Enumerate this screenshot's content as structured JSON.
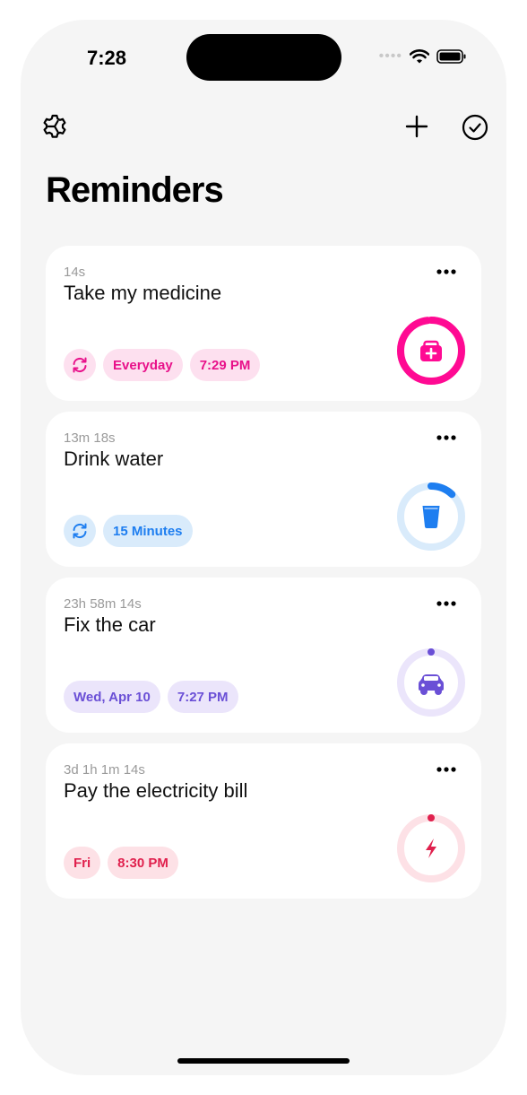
{
  "status_bar": {
    "time": "7:28"
  },
  "toolbar": {
    "settings_icon": "gear-icon",
    "add_icon": "plus-icon",
    "done_icon": "check-circle-icon"
  },
  "page": {
    "title": "Reminders"
  },
  "colors": {
    "pink": "#ff0a93",
    "blue": "#1e7ef0",
    "purple": "#6a4fd6",
    "red": "#e0204d"
  },
  "reminders": [
    {
      "time_left": "14s",
      "title": "Take my medicine",
      "repeat": true,
      "tags": [
        "Everyday",
        "7:29 PM"
      ],
      "icon": "medical-kit-icon",
      "progress": 0.98
    },
    {
      "time_left": "13m 18s",
      "title": "Drink water",
      "repeat": true,
      "tags": [
        "15 Minutes"
      ],
      "icon": "water-glass-icon",
      "progress": 0.12
    },
    {
      "time_left": "23h 58m 14s",
      "title": "Fix the car",
      "repeat": false,
      "tags": [
        "Wed, Apr 10",
        "7:27 PM"
      ],
      "icon": "car-icon",
      "progress": 0.0
    },
    {
      "time_left": "3d 1h 1m 14s",
      "title": "Pay the electricity bill",
      "repeat": false,
      "tags": [
        "Fri",
        "8:30 PM"
      ],
      "icon": "lightning-bolt-icon",
      "progress": 0.0
    }
  ]
}
